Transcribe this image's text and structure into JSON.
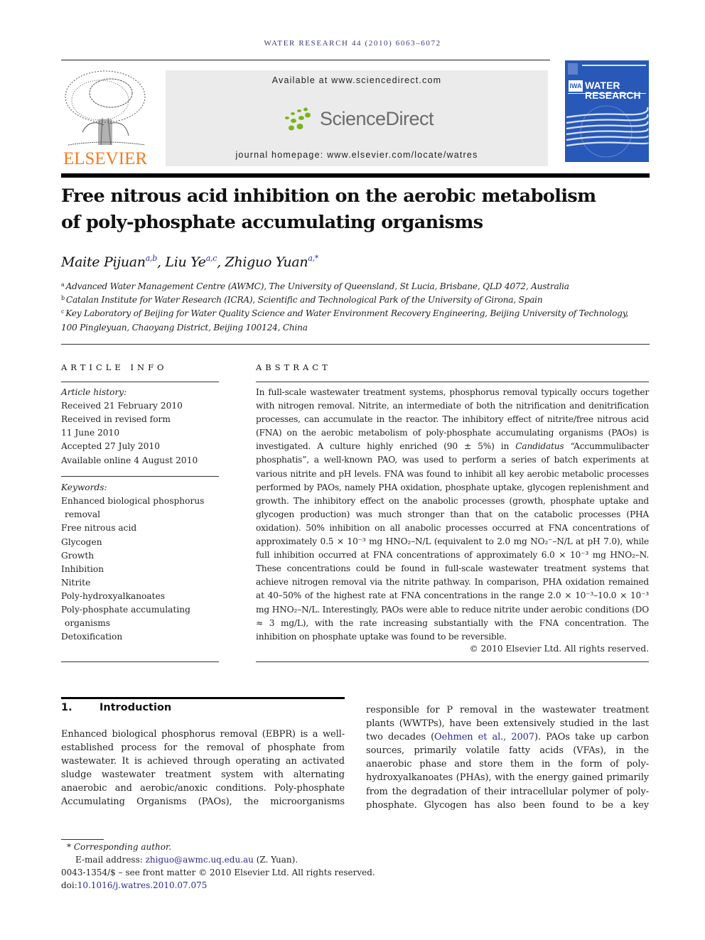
{
  "header": {
    "running_head": "WATER RESEARCH 44 (2010) 6063–6072",
    "publisher_logo_word": "ELSEVIER",
    "available_at": "Available at www.sciencedirect.com",
    "sciencedirect_logo": "ScienceDirect",
    "journal_homepage": "journal homepage: www.elsevier.com/locate/watres",
    "cover": {
      "iwa_mark": "IWA",
      "title_line1": "WATER",
      "title_line2": "RESEARCH",
      "brand_color": "#2859b8"
    },
    "publisher_color": "#f47a20"
  },
  "article": {
    "title_line1": "Free nitrous acid inhibition on the aerobic metabolism",
    "title_line2": "of poly-phosphate accumulating organisms",
    "authors": [
      {
        "name": "Maite Pijuan",
        "sup": "a,b",
        "sep": ", "
      },
      {
        "name": "Liu Ye",
        "sup": "a,c",
        "sep": ", "
      },
      {
        "name": "Zhiguo Yuan",
        "sup": "a,*",
        "sep": ""
      }
    ],
    "affiliations": [
      {
        "mark": "a",
        "text": "Advanced Water Management Centre (AWMC), The University of Queensland, St Lucia, Brisbane, QLD 4072, Australia"
      },
      {
        "mark": "b",
        "text": "Catalan Institute for Water Research (ICRA), Scientific and Technological Park of the University of Girona, Spain"
      },
      {
        "mark": "c",
        "text": "Key Laboratory of Beijing for Water Quality Science and Water Environment Recovery Engineering, Beijing University of Technology,"
      },
      {
        "mark": "",
        "text": "100 Pingleyuan, Chaoyang District, Beijing 100124, China"
      }
    ]
  },
  "article_info": {
    "heading": "ARTICLE INFO",
    "history_label": "Article history:",
    "history": [
      "Received 21 February 2010",
      "Received in revised form",
      "11 June 2010",
      "Accepted 27 July 2010",
      "Available online 4 August 2010"
    ],
    "keywords_label": "Keywords:",
    "keywords": [
      "Enhanced biological phosphorus",
      "removal",
      "Free nitrous acid",
      "Glycogen",
      "Growth",
      "Inhibition",
      "Nitrite",
      "Poly-hydroxyalkanoates",
      "Poly-phosphate accumulating",
      "organisms",
      "Detoxification"
    ]
  },
  "abstract": {
    "heading": "ABSTRACT",
    "p1": "In full-scale wastewater treatment systems, phosphorus removal typically occurs together with nitrogen removal. Nitrite, an intermediate of both the nitrification and denitrification processes, can accumulate in the reactor. The inhibitory effect of nitrite/free nitrous acid (FNA) on the aerobic metabolism of poly-phosphate accumulating organisms (PAOs) is investigated. A culture highly enriched (90 ± 5%) in ",
    "p1_italic": "Candidatus",
    "p2": " “Accummulibacter phosphatis”, a well-known PAO, was used to perform a series of batch experiments at various nitrite and pH levels. FNA was found to inhibit all key aerobic metabolic processes performed by PAOs, namely PHA oxidation, phosphate uptake, glycogen replenishment and growth. The inhibitory effect on the anabolic processes (growth, phosphate uptake and glycogen production) was much stronger than that on the catabolic processes (PHA oxidation). 50% inhibition on all anabolic processes occurred at FNA concentrations of approximately 0.5 × 10⁻³ mg HNO₂–N/L (equivalent to 2.0 mg NO₂⁻–N/L at pH 7.0), while full inhibition occurred at FNA concentrations of approximately 6.0 × 10⁻³ mg HNO₂–N. These concentrations could be found in full-scale wastewater treatment systems that achieve nitrogen removal via the nitrite pathway. In comparison, PHA oxidation remained at 40–50% of the highest rate at FNA concentrations in the range 2.0 × 10⁻³–10.0 × 10⁻³ mg HNO₂–N/L. Interestingly, PAOs were able to reduce nitrite under aerobic conditions (DO ≈ 3 mg/L), with the rate increasing substantially with the FNA concentration. The inhibition on phosphate uptake was found to be reversible.",
    "copyright": "© 2010 Elsevier Ltd. All rights reserved."
  },
  "introduction": {
    "number": "1.",
    "heading": "Introduction",
    "left_col": "Enhanced biological phosphorus removal (EBPR) is a well-established process for the removal of phosphate from wastewater. It is achieved through operating an activated sludge wastewater treatment system with alternating anaerobic and aerobic/anoxic conditions. Poly-phosphate Accumulating Organisms (PAOs), the microorganisms",
    "right_col_pre": "responsible for P removal in the wastewater treatment plants (WWTPs), have been extensively studied in the last two decades (",
    "right_col_cite": "Oehmen et al., 2007",
    "right_col_post": "). PAOs take up carbon sources, primarily volatile fatty acids (VFAs), in the anaerobic phase and store them in the form of poly-hydroxyalkanoates (PHAs), with the energy gained primarily from the degradation of their intracellular polymer of poly-phosphate. Glycogen has also been found to be a key"
  },
  "footnotes": {
    "star": "*",
    "corresponding": "Corresponding author.",
    "email_label": "E-mail address: ",
    "email": "zhiguo@awmc.uq.edu.au",
    "email_suffix": " (Z. Yuan).",
    "front_matter": "0043-1354/$ – see front matter © 2010 Elsevier Ltd. All rights reserved.",
    "doi_label": "doi:",
    "doi": "10.1016/j.watres.2010.07.075"
  }
}
